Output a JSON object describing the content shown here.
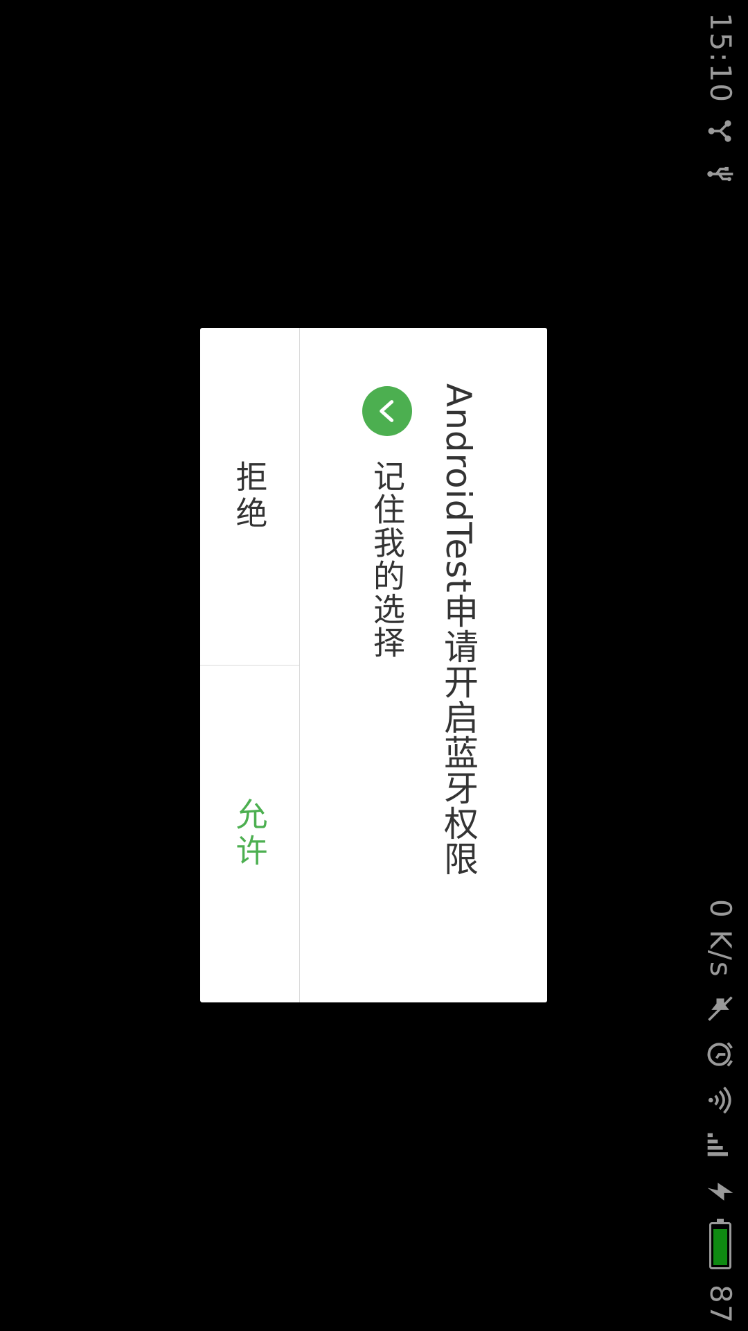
{
  "status_bar": {
    "time": "15:10",
    "net_speed": "0 K/s",
    "battery_level": "87",
    "signal_type": "4G",
    "icons": [
      "share-icon",
      "usb-icon",
      "mute-icon",
      "alarm-icon",
      "wifi-icon",
      "signal-icon",
      "charging-icon",
      "battery-icon"
    ],
    "battery_color": "#0f8a12"
  },
  "dialog": {
    "title": "AndroidTest申请开启蓝牙权限",
    "remember_label": "记住我的选择",
    "remember_checked": true,
    "deny_label": "拒绝",
    "allow_label": "允许",
    "accent_color": "#4caf50"
  }
}
